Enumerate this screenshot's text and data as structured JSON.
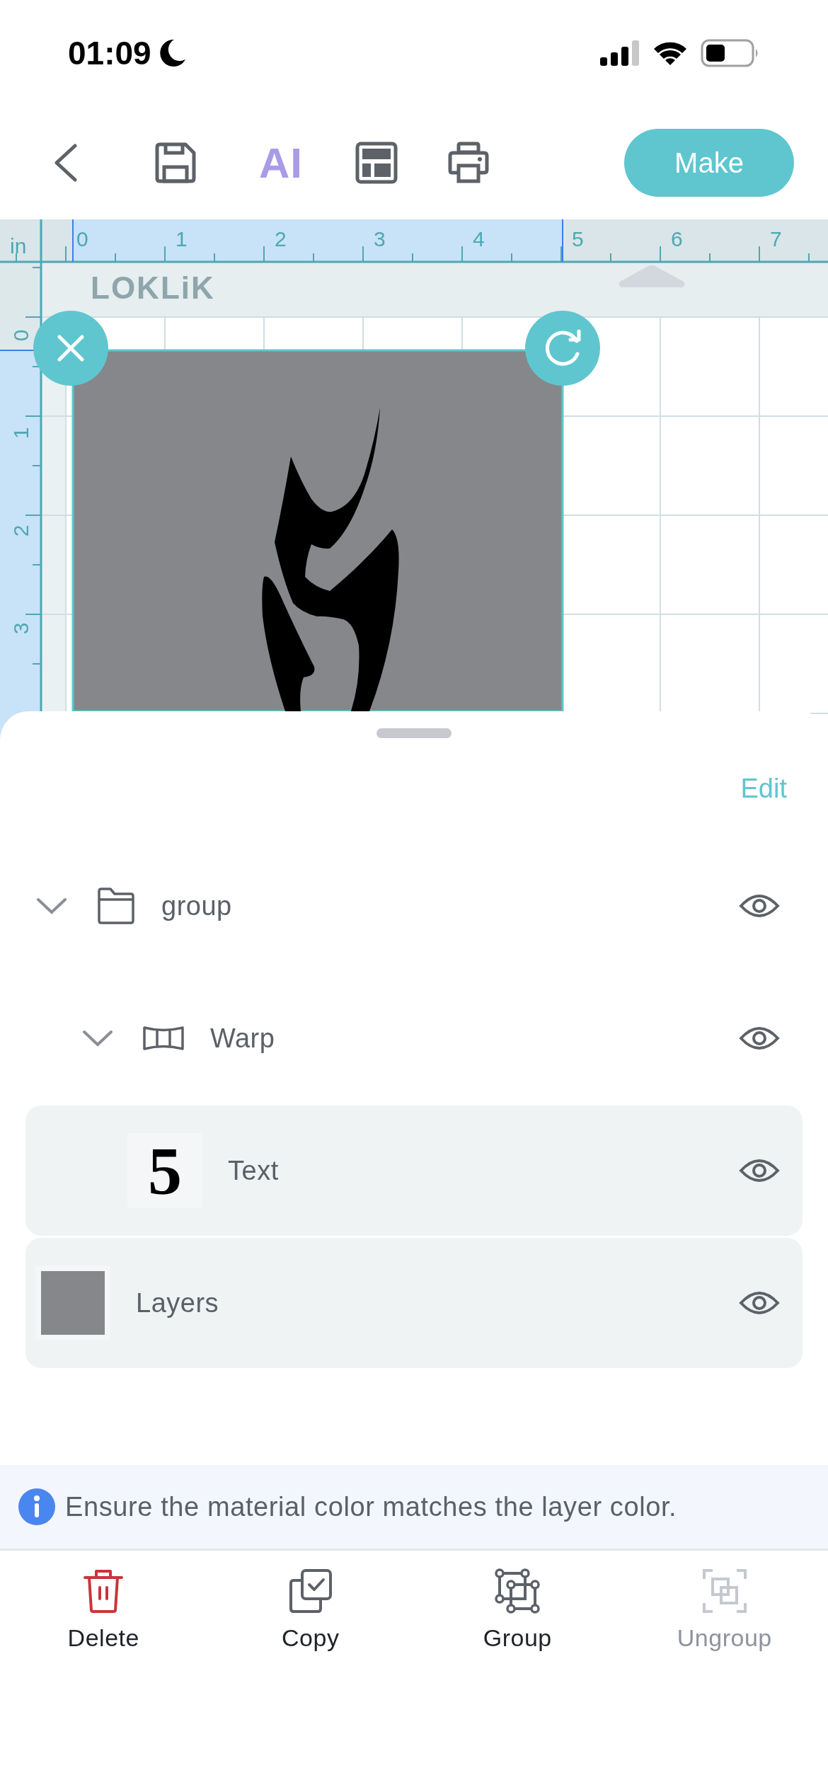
{
  "status_bar": {
    "time": "01:09"
  },
  "toolbar": {
    "ai_label": "AI",
    "make_button": "Make"
  },
  "ruler": {
    "unit": "in",
    "x_labels": [
      "0",
      "1",
      "2",
      "3",
      "4",
      "5",
      "6",
      "7"
    ],
    "y_labels": [
      "0",
      "1",
      "2",
      "3"
    ]
  },
  "canvas": {
    "brand_logo": "LOKLiK"
  },
  "layers_panel": {
    "edit_button": "Edit",
    "layers": [
      {
        "name": "group",
        "kind": "group",
        "expanded": true,
        "visible": true,
        "selected": false,
        "children": [
          {
            "name": "Warp",
            "kind": "warp",
            "expanded": true,
            "visible": true,
            "selected": false,
            "children": [
              {
                "name": "Text",
                "kind": "text",
                "thumbnail": "5",
                "visible": true,
                "selected": true
              }
            ]
          }
        ]
      },
      {
        "name": "Layers",
        "kind": "shape",
        "color": "#85878b",
        "visible": true,
        "selected": true
      }
    ]
  },
  "notice": "Ensure the material color matches the layer color.",
  "actions": [
    {
      "label": "Delete",
      "kind": "delete",
      "disabled": false
    },
    {
      "label": "Copy",
      "kind": "copy",
      "disabled": false
    },
    {
      "label": "Group",
      "kind": "group",
      "disabled": false
    },
    {
      "label": "Ungroup",
      "kind": "ungroup",
      "disabled": true
    }
  ]
}
